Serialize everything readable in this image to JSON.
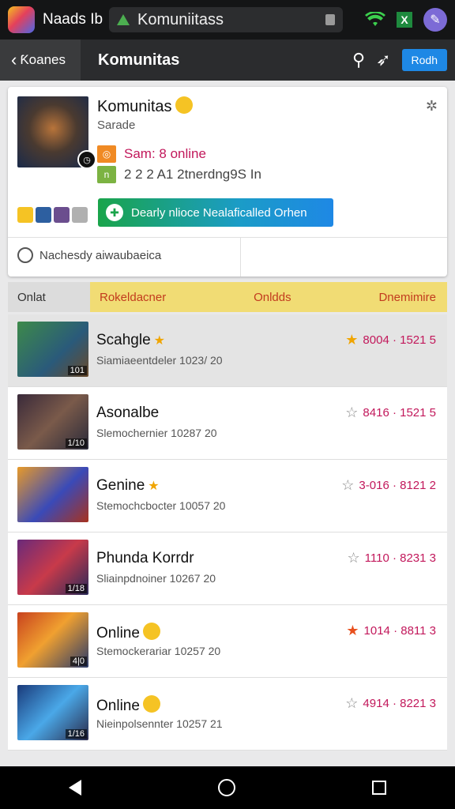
{
  "status_bar": {
    "app_title": "Naads Ib",
    "url": "Komuniitass"
  },
  "toolbar": {
    "back_label": "Ƙoanes",
    "title": "Komunitas",
    "action_label": "Rodh"
  },
  "community": {
    "title": "Komunitas",
    "subtitle": "Sarade",
    "online_text": "Sam: 8 online",
    "stats_text": "2 2 2  A1 2tnerdng9S  In",
    "cta_label": "Dearly nlioce Nealaficalled Orhen",
    "search_placeholder": "Nachesdy aiwaubaeica"
  },
  "table_header": {
    "left": "Onlat",
    "col1": "Rokeldacner",
    "col2": "Onldds",
    "col3": "Dnemimire"
  },
  "rows": [
    {
      "name": "Scahgle",
      "meta": "Siamiaeentdeler 1023/ 20",
      "score": "8004 · 1521  5",
      "tag": "101",
      "selected": true
    },
    {
      "name": "Asonalbe",
      "meta": "Slemochernier 10287 20",
      "score": "8416 · 1521  5",
      "tag": "1/10"
    },
    {
      "name": "Genine",
      "meta": "Stemochcbocter 10057 20",
      "score": "3-016 · 8121  2",
      "tag": ""
    },
    {
      "name": "Phunda Korrdr",
      "meta": "Sliainpdnoiner 10267 20",
      "score": "1110 · 8231  3",
      "tag": "1/18"
    },
    {
      "name": "Online",
      "meta": "Stemockerariar 10257 20",
      "score": "1014 · 8811  3",
      "tag": "4|0"
    },
    {
      "name": "Online",
      "meta": "Nieinpolsennter 10257 21",
      "score": "4914 · 8221  3",
      "tag": "1/16"
    }
  ],
  "colors": {
    "toolbar_bg": "#2b2c2e",
    "accent_blue": "#1e88e5",
    "header_yellow": "#f1dc74",
    "score_pink": "#c2185b"
  },
  "icons": [
    "search-icon",
    "share-icon",
    "gear-icon",
    "star-icon",
    "back-triangle-icon",
    "home-circle-icon",
    "recents-square-icon"
  ]
}
